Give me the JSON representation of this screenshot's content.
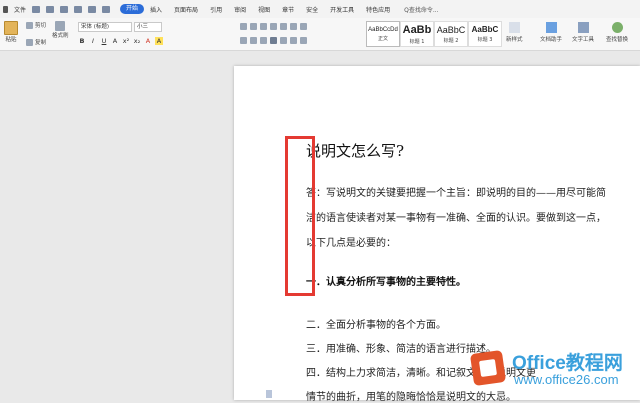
{
  "menu": {
    "file": "文件",
    "tabs": [
      "开始",
      "插入",
      "页面布局",
      "引用",
      "审阅",
      "视图",
      "章节",
      "安全",
      "开发工具",
      "特色应用"
    ],
    "active_tab": "开始",
    "search": "Q查找命令..."
  },
  "ribbon": {
    "cut": "剪切",
    "paste": "粘贴",
    "copy": "复制",
    "format_painter": "格式刷",
    "font_name": "宋体 (标题)",
    "font_size": "小三",
    "format_buttons": [
      "B",
      "I",
      "U",
      "A",
      "x²",
      "x₂",
      "A",
      "A"
    ],
    "styles": [
      {
        "sample": "AaBbCcDd",
        "label": "正文"
      },
      {
        "sample": "AaBb",
        "label": "标题 1"
      },
      {
        "sample": "AaBbC",
        "label": "标题 2"
      },
      {
        "sample": "AaBbC",
        "label": "标题 3"
      }
    ],
    "new_style": "新样式",
    "text_assist": "文档助手",
    "text_tools": "文字工具",
    "find_replace": "查找替换"
  },
  "document": {
    "title": "说明文怎么写?",
    "paragraph_lines": [
      "答：写说明文的关键要把握一个主旨：即说明的目的——用尽可能简",
      "洁的语言使读者对某一事物有一准确、全面的认识。要做到这一点，",
      "以下几点是必要的："
    ],
    "heading1": "一．认真分析所写事物的主要特性。",
    "items": [
      "二．全面分析事物的各个方面。",
      "三．用准确、形象、简洁的语言进行描述。",
      "四．结构上力求简洁，清晰。和记叙文相比说明文更",
      "情节的曲折，用笔的隐晦恰恰是说明文的大忌。"
    ]
  },
  "watermark": {
    "brand": "Office教程网",
    "url": "www.office26.com"
  },
  "colors": {
    "accent": "#2b6cd8",
    "highlight_box": "#e43a32",
    "watermark": "#3aa0dc"
  }
}
